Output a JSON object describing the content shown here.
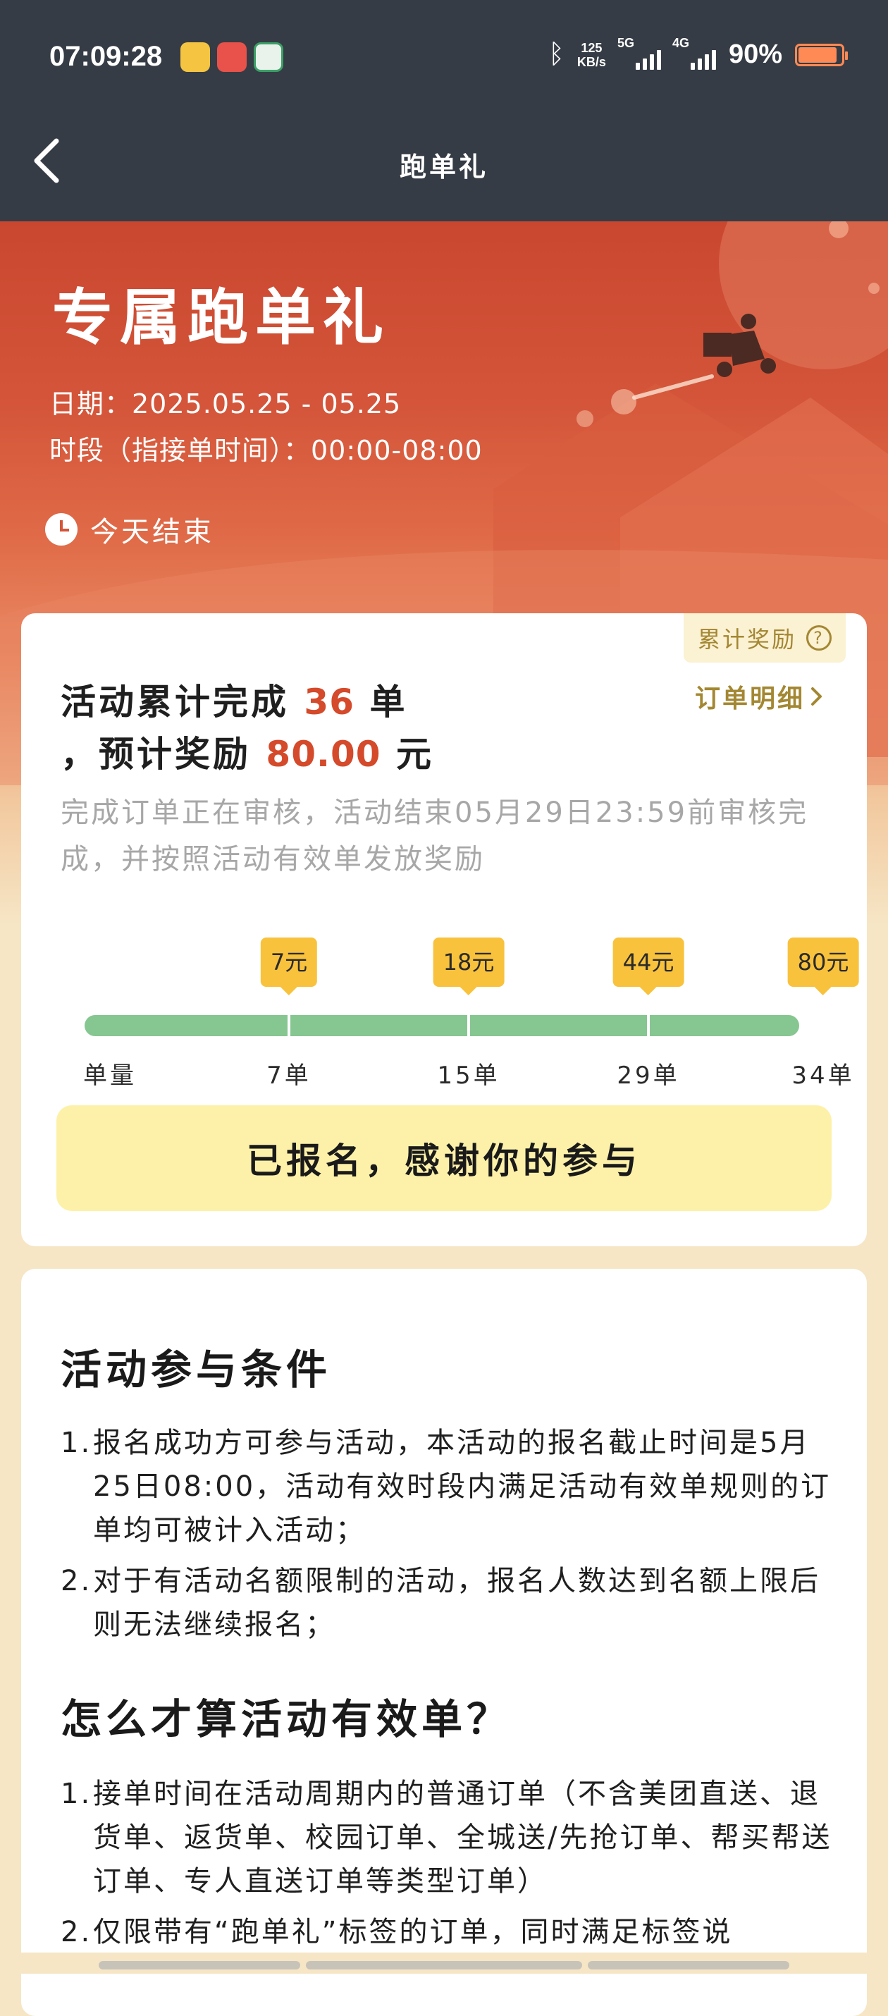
{
  "status_bar": {
    "time": "07:09:28",
    "net_speed_value": "125",
    "net_speed_unit": "KB/s",
    "sim1": "5G",
    "sim2": "4G",
    "battery_percent": "90%",
    "battery_level": 0.9,
    "icons": [
      "bluetooth-icon",
      "signal-icon",
      "battery-icon"
    ]
  },
  "nav": {
    "title": "跑单礼",
    "back_icon": "chevron-left-icon"
  },
  "hero": {
    "title": "专属跑单礼",
    "date_line": "日期：2025.05.25 - 05.25",
    "period_line": "时段（指接单时间）：00:00-08:00",
    "ends_text": "今天结束"
  },
  "summary": {
    "reward_tag": "累计奖励",
    "order_detail": "订单明细",
    "line1_prefix": "活动累计完成",
    "completed": "36",
    "line1_suffix": "单",
    "line2_prefix": "，预计奖励",
    "reward": "80.00",
    "line2_suffix": "元",
    "review_note": "完成订单正在审核，活动结束05月29日23:59前审核完成，并按照活动有效单发放奖励"
  },
  "progress": {
    "axis_label": "单量",
    "milestones": [
      {
        "orders": "7单",
        "reward": "7元"
      },
      {
        "orders": "15单",
        "reward": "18元"
      },
      {
        "orders": "29单",
        "reward": "44元"
      },
      {
        "orders": "34单",
        "reward": "80元"
      }
    ],
    "fill_fraction": 1.0
  },
  "joined_button": "已报名，感谢你的参与",
  "conditions": {
    "title": "活动参与条件",
    "items": [
      {
        "num": "1.",
        "text": "报名成功方可参与活动，本活动的报名截止时间是5月25日08:00，活动有效时段内满足活动有效单规则的订单均可被计入活动；"
      },
      {
        "num": "2.",
        "text": "对于有活动名额限制的活动，报名人数达到名额上限后则无法继续报名；"
      }
    ]
  },
  "valid_orders": {
    "title": "怎么才算活动有效单？",
    "items": [
      {
        "num": "1.",
        "text": "接单时间在活动周期内的普通订单（不含美团直送、退货单、返货单、校园订单、全城送/先抢订单、帮买帮送订单、专人直送订单等类型订单）"
      },
      {
        "num": "2.",
        "text": "仅限带有“跑单礼”标签的订单，同时满足标签说"
      }
    ]
  },
  "colors": {
    "status_bg": "#363c45",
    "accent_red": "#d44a2a",
    "gold": "#a38732",
    "progress_green": "#86c691",
    "tip_yellow": "#f9c23c",
    "button_yellow": "#fdf1a9"
  }
}
